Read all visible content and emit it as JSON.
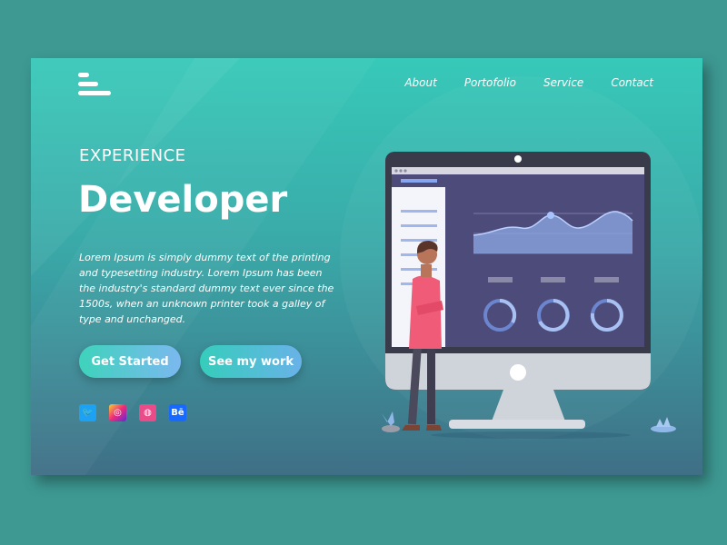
{
  "nav": {
    "about": "About",
    "portfolio": "Portofolio",
    "service": "Service",
    "contact": "Contact"
  },
  "hero": {
    "eyebrow": "EXPERIENCE",
    "title": "Developer",
    "description": "Lorem Ipsum is simply dummy text of the printing and typesetting industry. Lorem Ipsum has been the industry's standard dummy text ever since the 1500s, when an unknown printer took a galley of type and unchanged.",
    "cta_primary": "Get Started",
    "cta_secondary": "See my work"
  },
  "socials": {
    "twitter_glyph": "🐦",
    "instagram_glyph": "◎",
    "dribbble_glyph": "◍",
    "behance_glyph": "Bē"
  },
  "icons": [
    "menu-icon",
    "twitter-icon",
    "instagram-icon",
    "dribbble-icon",
    "behance-icon"
  ],
  "colors": {
    "gradient_top": "#37c9b9",
    "gradient_bottom": "#3f6f86",
    "accent": "#7bb8f0"
  }
}
